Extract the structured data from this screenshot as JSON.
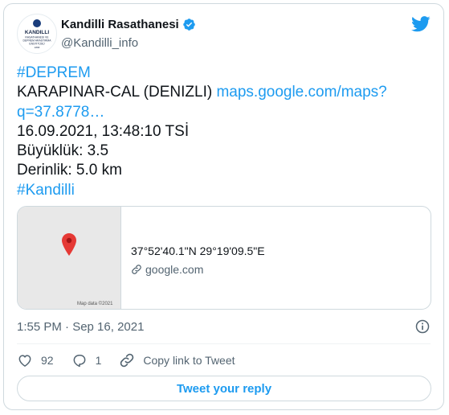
{
  "author": {
    "display_name": "Kandilli Rasathanesi",
    "handle": "@Kandilli_info",
    "avatar_text": [
      "KANDILLI",
      "RASATHANESI VE",
      "DEPREM ARASTIRMA",
      "ENSTITÜSÜ",
      "1868"
    ],
    "verified": true
  },
  "tweet": {
    "hashtag_top": "#DEPREM",
    "location": "KARAPINAR-CAL (DENIZLI)",
    "map_link_1": "maps.google.com/maps?",
    "map_link_2": "q=37.8778…",
    "datetime": "16.09.2021, 13:48:10 TSİ",
    "magnitude": "Büyüklük: 3.5",
    "depth": "Derinlik: 5.0 km",
    "hashtag_bottom": "#Kandilli"
  },
  "card": {
    "coords": "37°52'40.1\"N 29°19'09.5\"E",
    "domain": "google.com",
    "map_credit": "Map data ©2021"
  },
  "meta": {
    "timestamp": "1:55 PM · Sep 16, 2021"
  },
  "actions": {
    "likes": "92",
    "replies": "1",
    "copy_link": "Copy link to Tweet"
  },
  "reply_button": "Tweet your reply",
  "colors": {
    "accent": "#1d9bf0",
    "text": "#0f1419",
    "muted": "#536471",
    "pin": "#e53935"
  }
}
